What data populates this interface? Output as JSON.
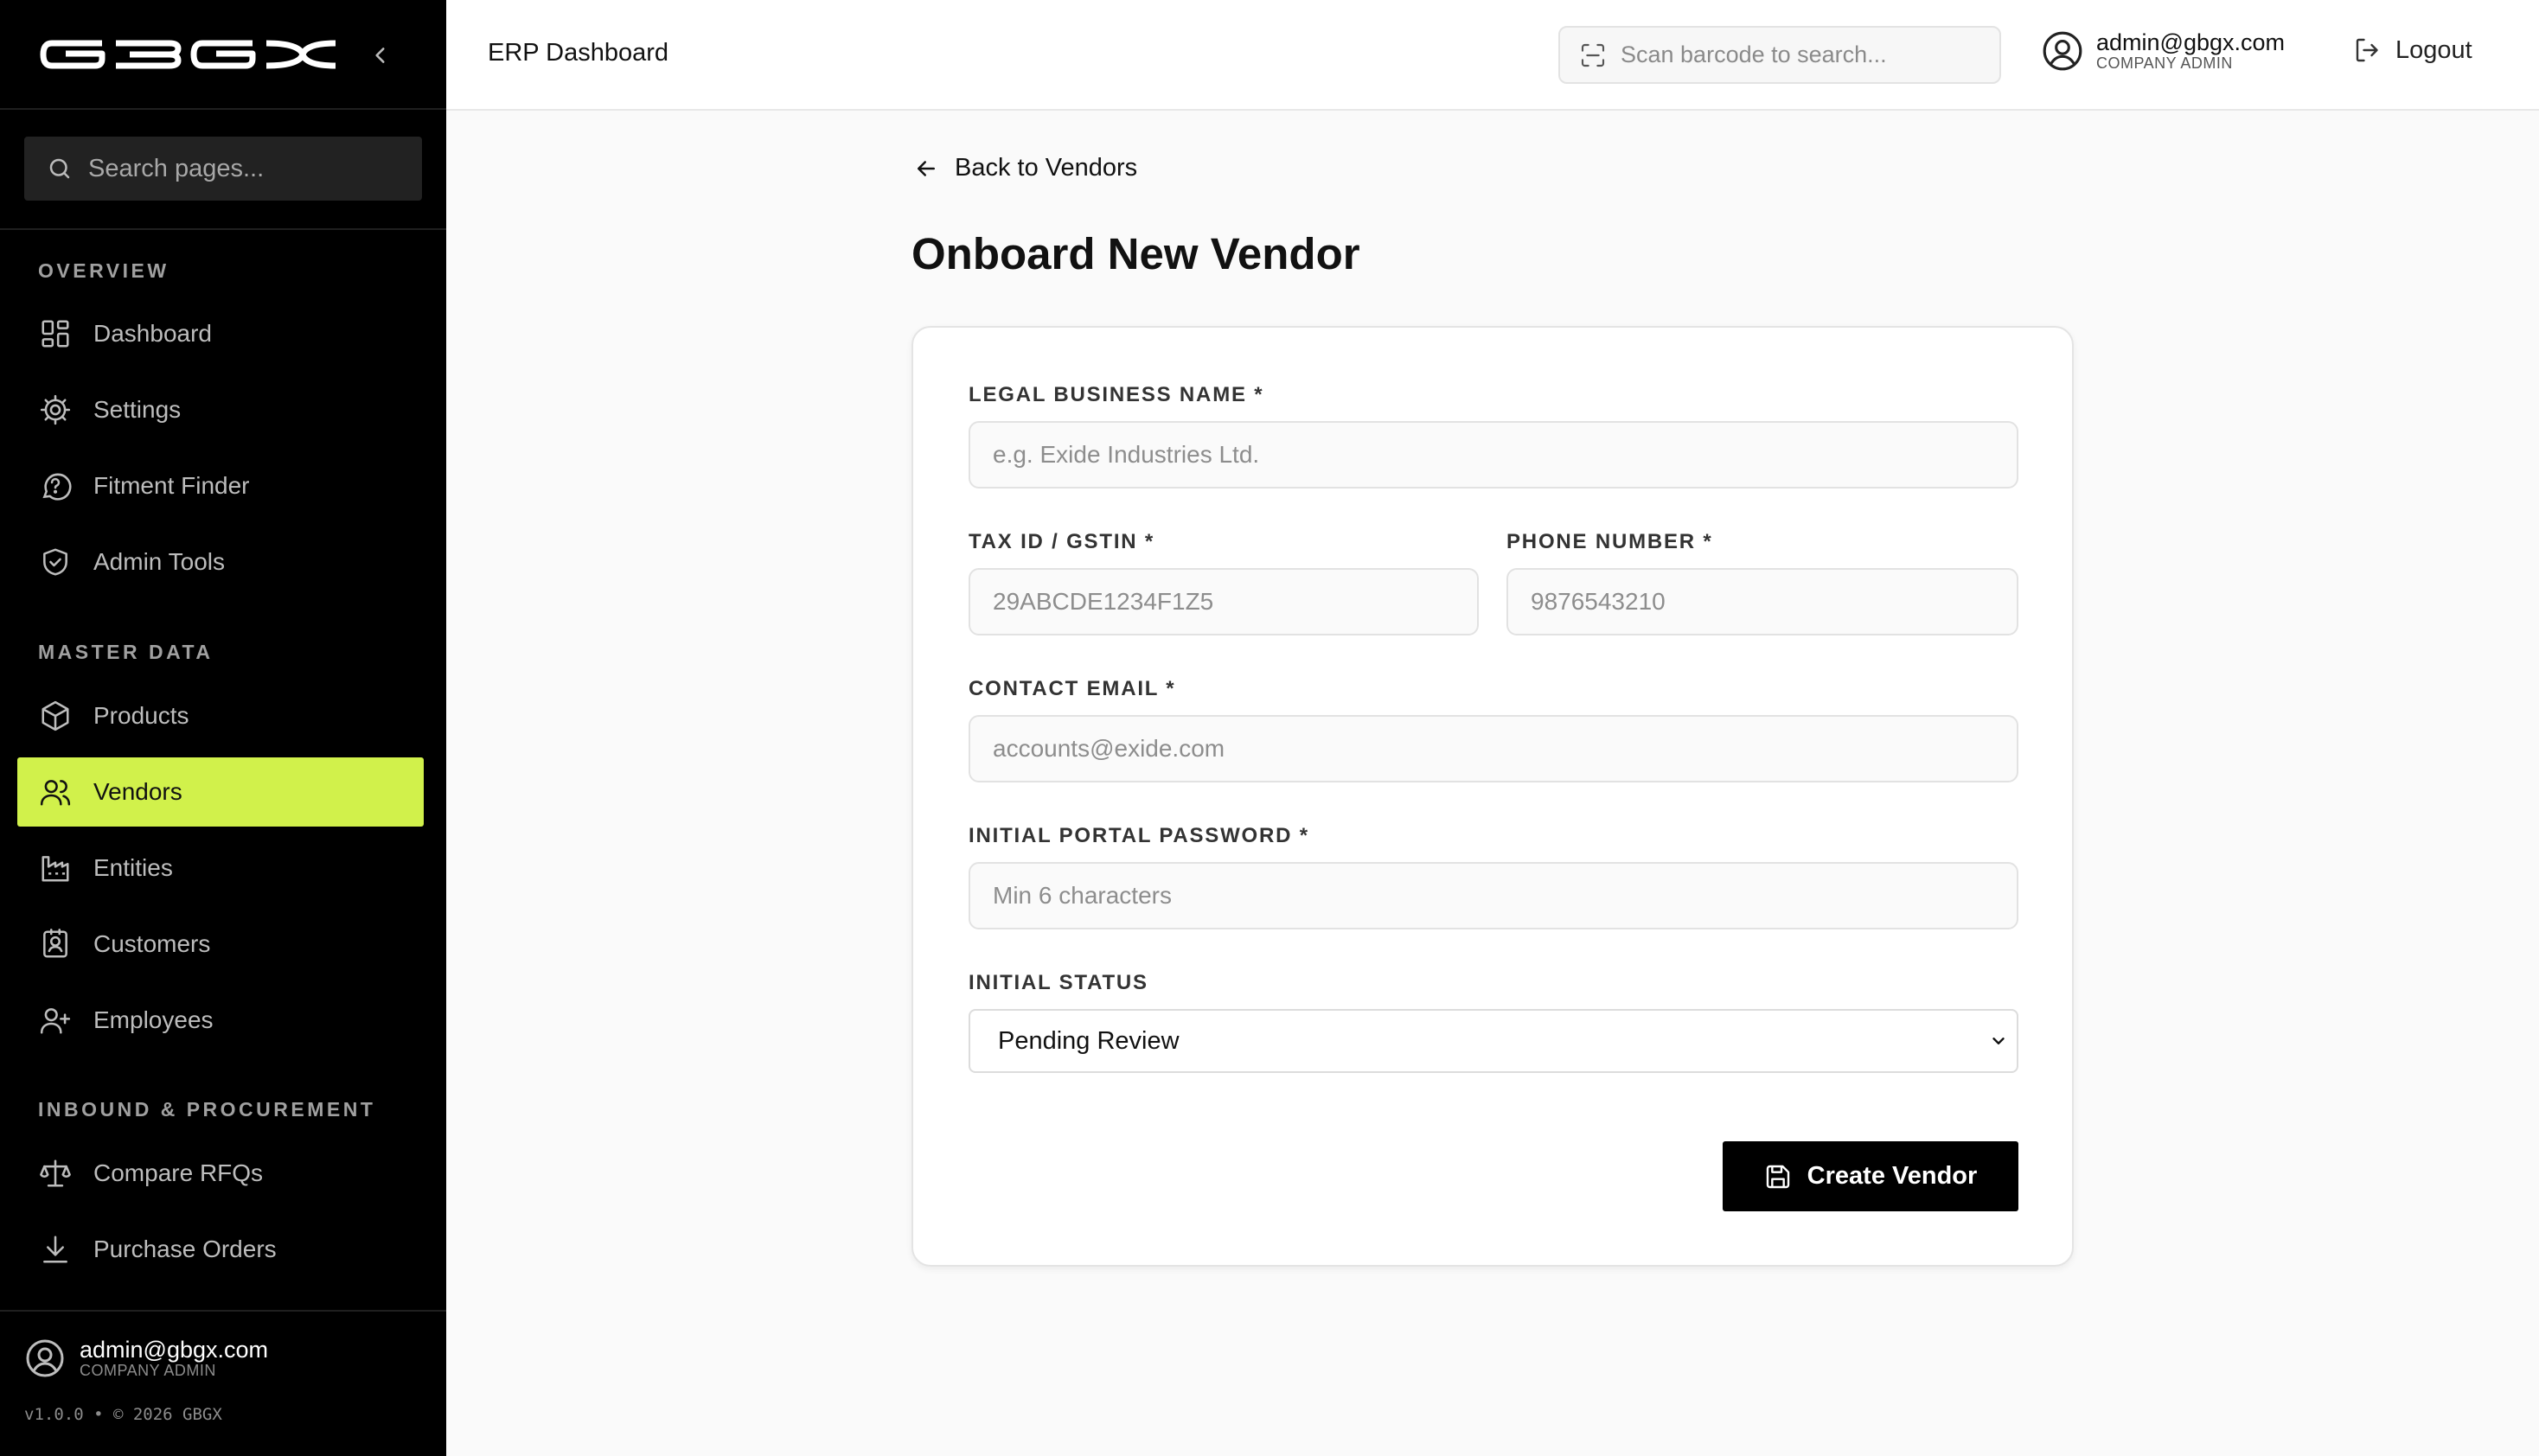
{
  "sidebar": {
    "logo_text": "GBGX",
    "search_placeholder": "Search pages...",
    "sections": [
      {
        "title": "OVERVIEW"
      },
      {
        "title": "MASTER DATA"
      },
      {
        "title": "INBOUND & PROCUREMENT"
      }
    ],
    "items": [
      {
        "label": "Dashboard",
        "icon": "dashboard-icon"
      },
      {
        "label": "Settings",
        "icon": "gear-icon"
      },
      {
        "label": "Fitment Finder",
        "icon": "help-circle-icon"
      },
      {
        "label": "Admin Tools",
        "icon": "shield-check-icon"
      },
      {
        "label": "Products",
        "icon": "box-icon"
      },
      {
        "label": "Vendors",
        "icon": "users-icon",
        "active": true
      },
      {
        "label": "Entities",
        "icon": "factory-icon"
      },
      {
        "label": "Customers",
        "icon": "contact-icon"
      },
      {
        "label": "Employees",
        "icon": "user-plus-icon"
      },
      {
        "label": "Compare RFQs",
        "icon": "scale-icon"
      },
      {
        "label": "Purchase Orders",
        "icon": "download-icon"
      }
    ],
    "footer": {
      "email": "admin@gbgx.com",
      "role": "COMPANY ADMIN",
      "version": "v1.0.0 • © 2026 GBGX"
    }
  },
  "header": {
    "title": "ERP Dashboard",
    "barcode_placeholder": "Scan barcode to search...",
    "user_email": "admin@gbgx.com",
    "user_role": "COMPANY ADMIN",
    "logout_label": "Logout"
  },
  "main": {
    "back_label": "Back to Vendors",
    "page_title": "Onboard New Vendor",
    "form": {
      "legal_name": {
        "label": "LEGAL BUSINESS NAME *",
        "placeholder": "e.g. Exide Industries Ltd.",
        "value": ""
      },
      "tax_id": {
        "label": "TAX ID / GSTIN *",
        "placeholder": "29ABCDE1234F1Z5",
        "value": ""
      },
      "phone": {
        "label": "PHONE NUMBER *",
        "placeholder": "9876543210",
        "value": ""
      },
      "email": {
        "label": "CONTACT EMAIL *",
        "placeholder": "accounts@exide.com",
        "value": ""
      },
      "password": {
        "label": "INITIAL PORTAL PASSWORD *",
        "placeholder": "Min 6 characters",
        "value": ""
      },
      "status": {
        "label": "INITIAL STATUS",
        "selected": "Pending Review"
      },
      "submit_label": "Create Vendor"
    }
  },
  "colors": {
    "sidebar_bg": "#000000",
    "accent": "#d1f14b",
    "page_bg": "#fafafa",
    "button_bg": "#000000"
  }
}
